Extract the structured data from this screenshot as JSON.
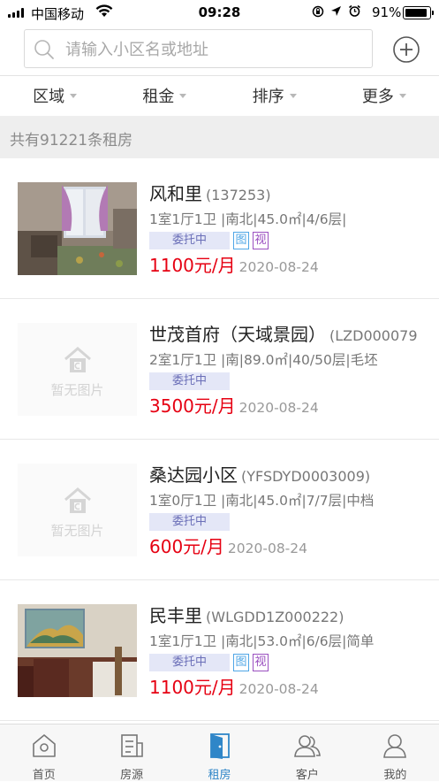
{
  "status_bar": {
    "carrier": "中国移动",
    "time": "09:28",
    "battery": "91%",
    "battery_level": 0.91
  },
  "search": {
    "placeholder": "请输入小区名或地址"
  },
  "filters": [
    "区域",
    "租金",
    "排序",
    "更多"
  ],
  "count_text": "共有91221条租房",
  "listings": [
    {
      "name": "风和里",
      "code": "(137253)",
      "meta": "1室1厅1卫 |南北|45.0㎡|4/6层|",
      "tag": "委托中",
      "has_img": true,
      "has_video": true,
      "img_tag": "图",
      "video_tag": "视",
      "price": "1100元/月",
      "date": "2020-08-24",
      "photo": "bedroom"
    },
    {
      "name": "世茂首府（天域景园）",
      "code": "(LZD000079",
      "meta": "2室1厅1卫 |南|89.0㎡|40/50层|毛坯",
      "tag": "委托中",
      "has_img": false,
      "has_video": false,
      "price": "3500元/月",
      "date": "2020-08-24",
      "photo": "none",
      "no_photo_text": "暂无图片"
    },
    {
      "name": "桑达园小区",
      "code": "(YFSDYD0003009)",
      "meta": "1室0厅1卫 |南北|45.0㎡|7/7层|中档",
      "tag": "委托中",
      "has_img": false,
      "has_video": false,
      "price": "600元/月",
      "date": "2020-08-24",
      "photo": "none",
      "no_photo_text": "暂无图片"
    },
    {
      "name": "民丰里",
      "code": "(WLGDD1Z000222)",
      "meta": "1室1厅1卫 |南北|53.0㎡|6/6层|简单",
      "tag": "委托中",
      "has_img": true,
      "has_video": true,
      "img_tag": "图",
      "video_tag": "视",
      "price": "1100元/月",
      "date": "2020-08-24",
      "photo": "livingroom"
    }
  ],
  "tabbar": [
    {
      "label": "首页",
      "icon": "home-icon",
      "active": false
    },
    {
      "label": "房源",
      "icon": "listing-icon",
      "active": false
    },
    {
      "label": "租房",
      "icon": "door-icon",
      "active": true
    },
    {
      "label": "客户",
      "icon": "customers-icon",
      "active": false
    },
    {
      "label": "我的",
      "icon": "profile-icon",
      "active": false
    }
  ],
  "colors": {
    "accent": "#2f86c8",
    "price": "#e60012",
    "tag_bg": "#e4e7f7"
  }
}
